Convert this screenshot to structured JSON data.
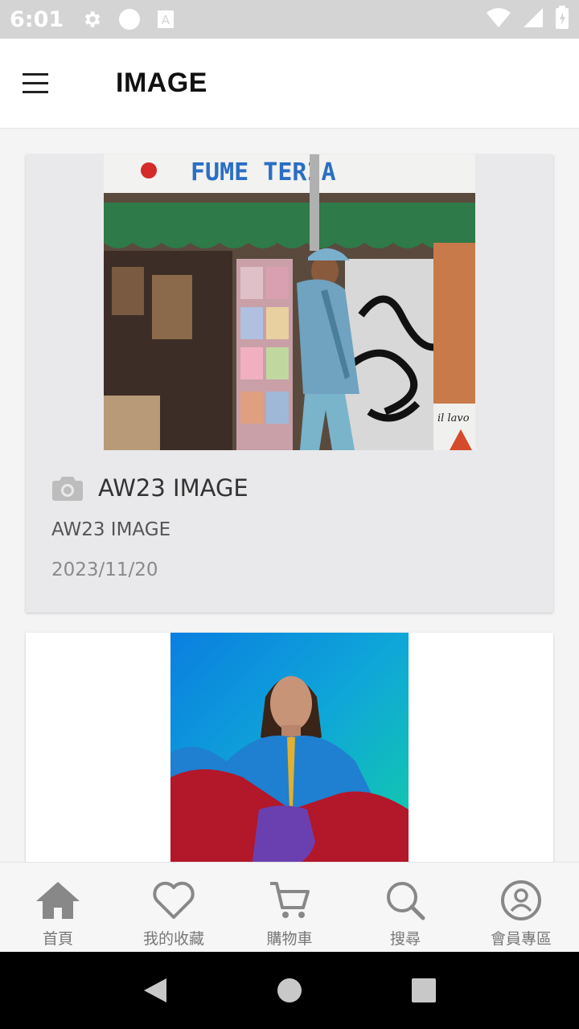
{
  "status_bar": {
    "time": "6:01",
    "icons_left": [
      "settings-icon",
      "circle-icon",
      "font-icon"
    ],
    "icons_right": [
      "wifi-icon",
      "signal-icon",
      "battery-icon"
    ]
  },
  "app_bar": {
    "title": "IMAGE",
    "menu_icon": "hamburger-menu-icon"
  },
  "cards": [
    {
      "title": "AW23 IMAGE",
      "subtitle": "AW23 IMAGE",
      "date": "2023/11/20",
      "icon": "camera-icon",
      "photo_sign_text": "FUME TERIA",
      "photo_sign2_text": "il lavo"
    },
    {
      "title": "",
      "subtitle": "",
      "date": ""
    }
  ],
  "bottom_nav": {
    "items": [
      {
        "label": "首頁",
        "icon": "home-icon"
      },
      {
        "label": "我的收藏",
        "icon": "heart-icon"
      },
      {
        "label": "購物車",
        "icon": "cart-icon"
      },
      {
        "label": "搜尋",
        "icon": "search-icon"
      },
      {
        "label": "會員專區",
        "icon": "account-icon"
      }
    ]
  },
  "system_nav": {
    "buttons": [
      "back-icon",
      "home-circle-icon",
      "recents-icon"
    ]
  },
  "colors": {
    "status_bar": "#d4d4d4",
    "card_bg": "#e9e9eb",
    "nav_icon": "#888888",
    "text_dark": "#333333"
  }
}
